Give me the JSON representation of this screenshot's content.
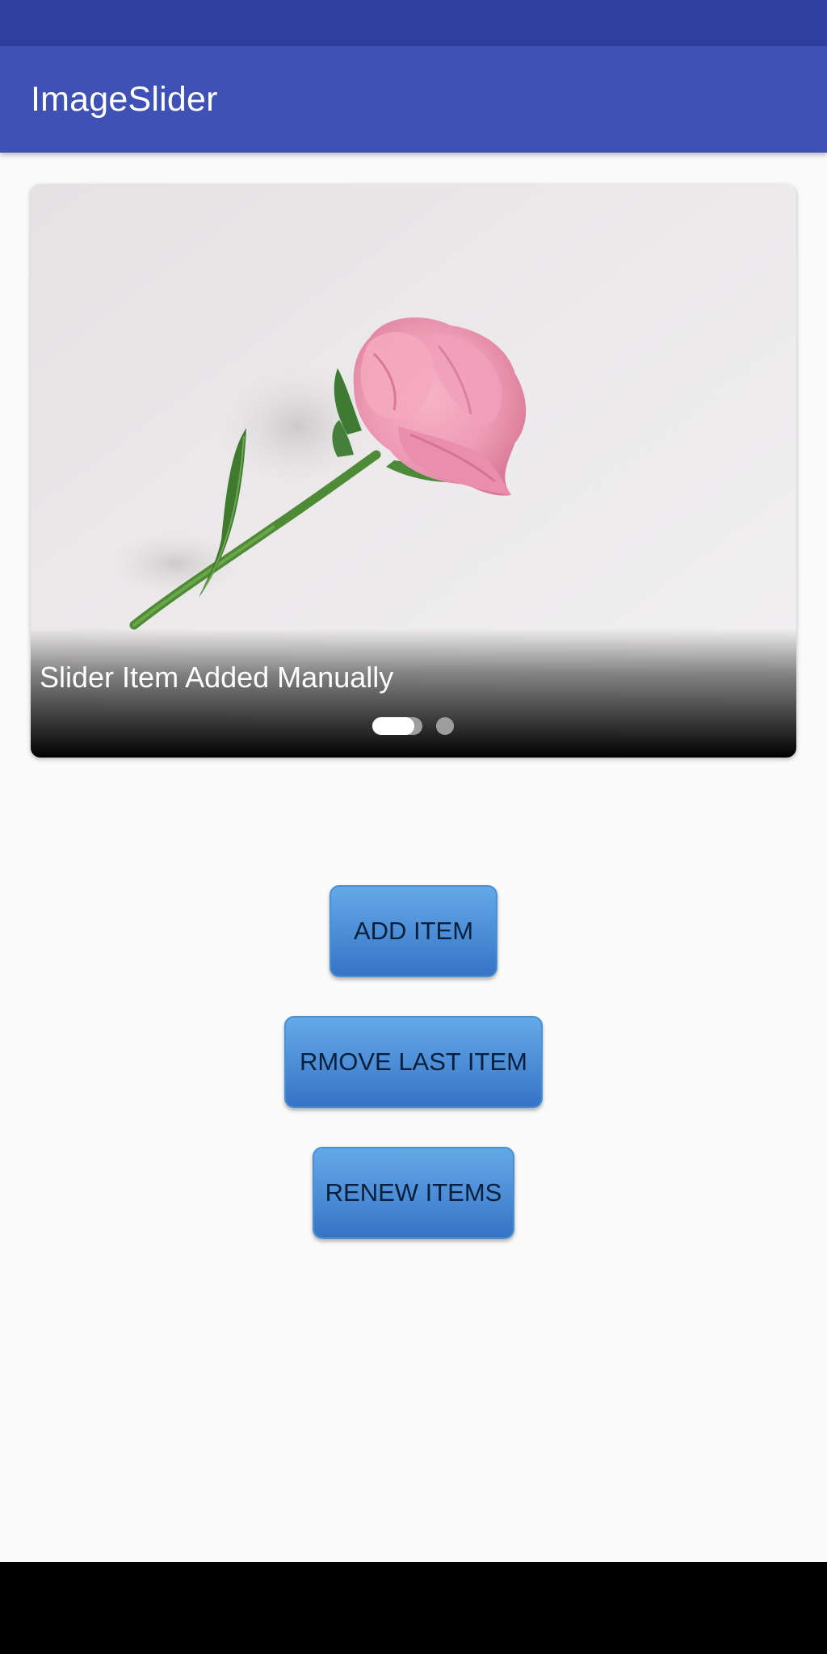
{
  "app": {
    "title": "ImageSlider"
  },
  "slider": {
    "caption": "Slider Item Added Manually",
    "image": "pink-rose-photo",
    "indicator": {
      "count": 2,
      "active_index": 0
    }
  },
  "buttons": {
    "add": "ADD ITEM",
    "remove_last": "RMOVE LAST ITEM",
    "renew": "RENEW ITEMS"
  },
  "colors": {
    "status_bar": "#303f9f",
    "app_bar": "#3f51b5",
    "button_blue": "#4d8fd8",
    "background": "#fafafa"
  }
}
